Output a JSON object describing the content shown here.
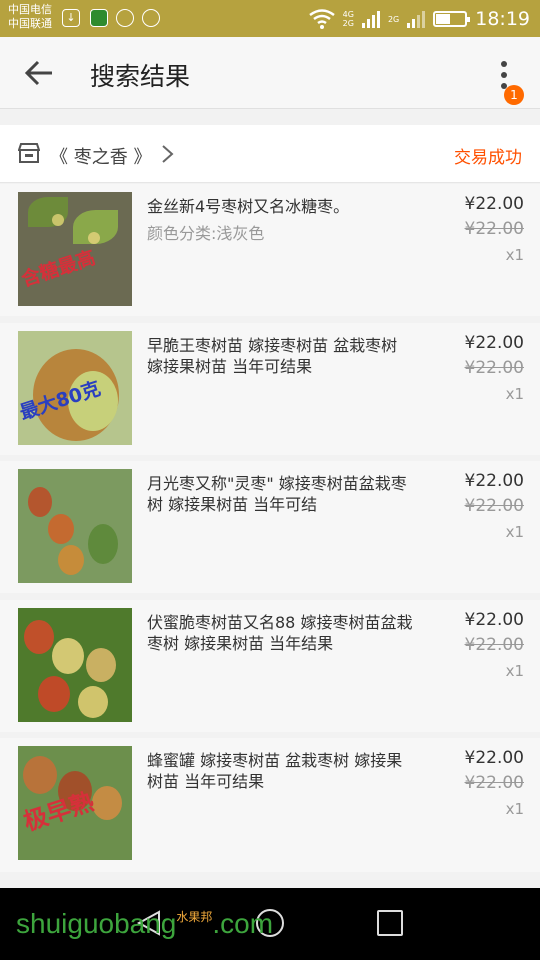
{
  "status_bar": {
    "carrier_1": "中国电信",
    "carrier_2": "中国联通",
    "net_1": "4G",
    "net_2": "2G",
    "net_3": "2G",
    "time": "18:19",
    "battery_level": 0.45
  },
  "header": {
    "title": "搜索结果",
    "notification_count": "1"
  },
  "shop": {
    "name": "《 枣之香 》",
    "order_status": "交易成功"
  },
  "items": [
    {
      "name": "金丝新4号枣树又名冰糖枣。",
      "sku": "颜色分类:浅灰色",
      "price": "¥22.00",
      "original_price": "¥22.00",
      "quantity": "x1",
      "image_text": "含糖最高"
    },
    {
      "name": "早脆王枣树苗 嫁接枣树苗 盆栽枣树  嫁接果树苗 当年可结果",
      "sku": "",
      "price": "¥22.00",
      "original_price": "¥22.00",
      "quantity": "x1",
      "image_text": "最大80克"
    },
    {
      "name": "月光枣又称\"灵枣\" 嫁接枣树苗盆栽枣树  嫁接果树苗 当年可结",
      "sku": "",
      "price": "¥22.00",
      "original_price": "¥22.00",
      "quantity": "x1",
      "image_text": ""
    },
    {
      "name": "伏蜜脆枣树苗又名88 嫁接枣树苗盆栽枣树 嫁接果树苗 当年结果",
      "sku": "",
      "price": "¥22.00",
      "original_price": "¥22.00",
      "quantity": "x1",
      "image_text": ""
    },
    {
      "name": "蜂蜜罐  嫁接枣树苗 盆栽枣树  嫁接果树苗 当年可结果",
      "sku": "",
      "price": "¥22.00",
      "original_price": "¥22.00",
      "quantity": "x1",
      "image_text": "极早熟"
    }
  ],
  "watermark": {
    "text": "shuiguobang",
    "suffix": ".com",
    "cn": "水果邦"
  },
  "colors": {
    "accent": "#ff5000",
    "status_bar": "#b6a23f"
  }
}
